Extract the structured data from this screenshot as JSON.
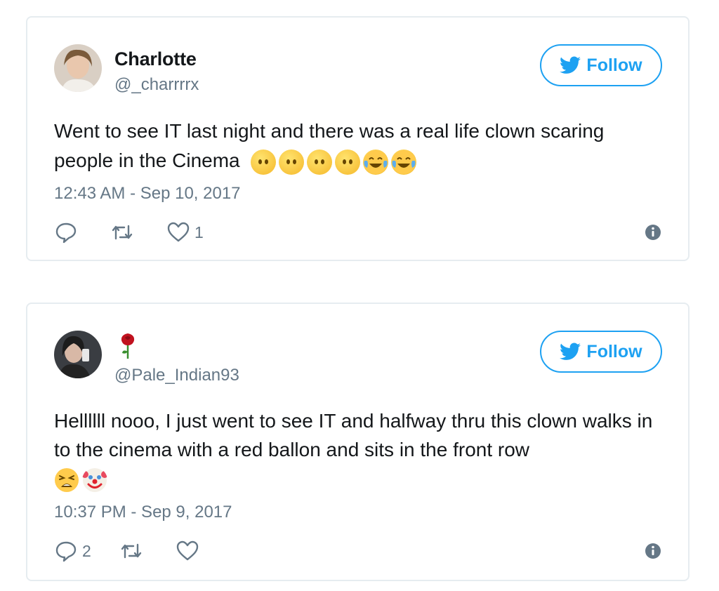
{
  "tweets": [
    {
      "display_name": "Charlotte",
      "handle": "@_charrrrx",
      "follow_label": "Follow",
      "text": "Went to see IT last night and there was a real life clown scaring people in the Cinema",
      "emojis": [
        "face-without-mouth",
        "face-without-mouth",
        "face-without-mouth",
        "face-without-mouth",
        "face-with-tears-of-joy",
        "face-with-tears-of-joy"
      ],
      "timestamp": "12:43 AM - Sep 10, 2017",
      "reply_count": "",
      "retweet_count": "",
      "like_count": "1"
    },
    {
      "display_name_icon": "rose-icon",
      "handle": "@Pale_Indian93",
      "follow_label": "Follow",
      "text": "Hellllll nooo, I just went to see IT and halfway thru this clown walks in to the cinema with a red ballon and sits in the front row",
      "emojis": [
        "weary-face",
        "clown-face"
      ],
      "timestamp": "10:37 PM - Sep 9, 2017",
      "reply_count": "2",
      "retweet_count": "",
      "like_count": ""
    }
  ],
  "colors": {
    "accent": "#1da1f2",
    "secondary_text": "#657786",
    "border": "#e6ecf0"
  },
  "icons": {
    "follow": "twitter-bird-icon",
    "reply": "reply-icon",
    "retweet": "retweet-icon",
    "like": "heart-icon",
    "info": "info-icon"
  }
}
